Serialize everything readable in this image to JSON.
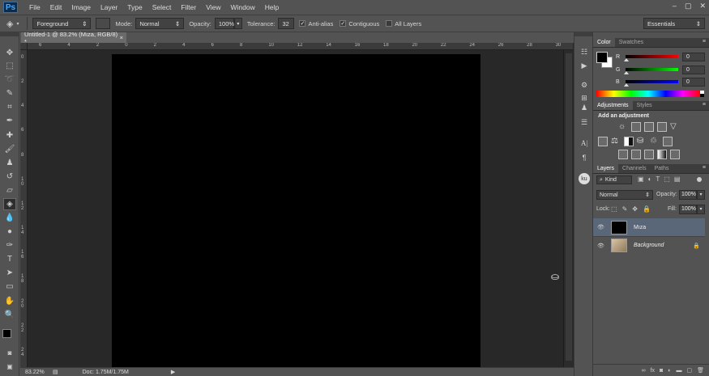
{
  "menubar": {
    "logo": "Ps",
    "items": [
      "File",
      "Edit",
      "Image",
      "Layer",
      "Type",
      "Select",
      "Filter",
      "View",
      "Window",
      "Help"
    ],
    "controls": [
      "–",
      "▢",
      "✕"
    ]
  },
  "options": {
    "fill_source": "Foreground",
    "mode_label": "Mode:",
    "mode_value": "Normal",
    "opacity_label": "Opacity:",
    "opacity_value": "100%",
    "tolerance_label": "Tolerance:",
    "tolerance_value": "32",
    "anti_alias_label": "Anti-alias",
    "contiguous_label": "Contiguous",
    "all_layers_label": "All Layers",
    "workspace": "Essentials"
  },
  "document": {
    "tab_title": "Untitled-1 @ 83.2% (Mıza, RGB/8) *",
    "tab_close": "×",
    "ruler_top": [
      "6",
      "4",
      "2",
      "0",
      "2",
      "4",
      "6",
      "8",
      "10",
      "12",
      "14",
      "16",
      "18",
      "20",
      "22",
      "24",
      "26",
      "28",
      "30"
    ],
    "ruler_left": [
      "0",
      "2",
      "4",
      "6",
      "8",
      "1 0",
      "1 2",
      "1 4",
      "1 6",
      "1 8",
      "2 0",
      "2 2",
      "2 4"
    ],
    "zoom": "83.22%",
    "doc_info": "Doc: 1.75M/1.75M"
  },
  "color_panel": {
    "tabs": [
      "Color",
      "Swatches"
    ],
    "channels": [
      {
        "label": "R",
        "value": "0",
        "color_from": "#000000",
        "color_to": "#ff0000"
      },
      {
        "label": "G",
        "value": "0",
        "color_from": "#000000",
        "color_to": "#00ff00"
      },
      {
        "label": "B",
        "value": "0",
        "color_from": "#000000",
        "color_to": "#0000ff"
      }
    ]
  },
  "adjustments_panel": {
    "tabs": [
      "Adjustments",
      "Styles"
    ],
    "heading": "Add an adjustment"
  },
  "layers_panel": {
    "tabs": [
      "Layers",
      "Channels",
      "Paths"
    ],
    "kind_label": "Kind",
    "blend_mode": "Normal",
    "opacity_label": "Opacity:",
    "opacity_value": "100%",
    "lock_label": "Lock:",
    "fill_label": "Fill:",
    "fill_value": "100%",
    "layers": [
      {
        "name": "Mıza",
        "selected": true,
        "thumb": "#000000"
      },
      {
        "name": "Background",
        "selected": false,
        "thumb": "#b9a78a"
      }
    ],
    "footer_icons": [
      "link-icon",
      "fx-icon",
      "mask-icon",
      "adjustment-icon",
      "group-icon",
      "new-layer-icon",
      "trash-icon"
    ]
  },
  "colors": {
    "ui_bg": "#535353",
    "canvas": "#000000",
    "pasteboard": "#282828",
    "selected_layer": "#596779"
  }
}
